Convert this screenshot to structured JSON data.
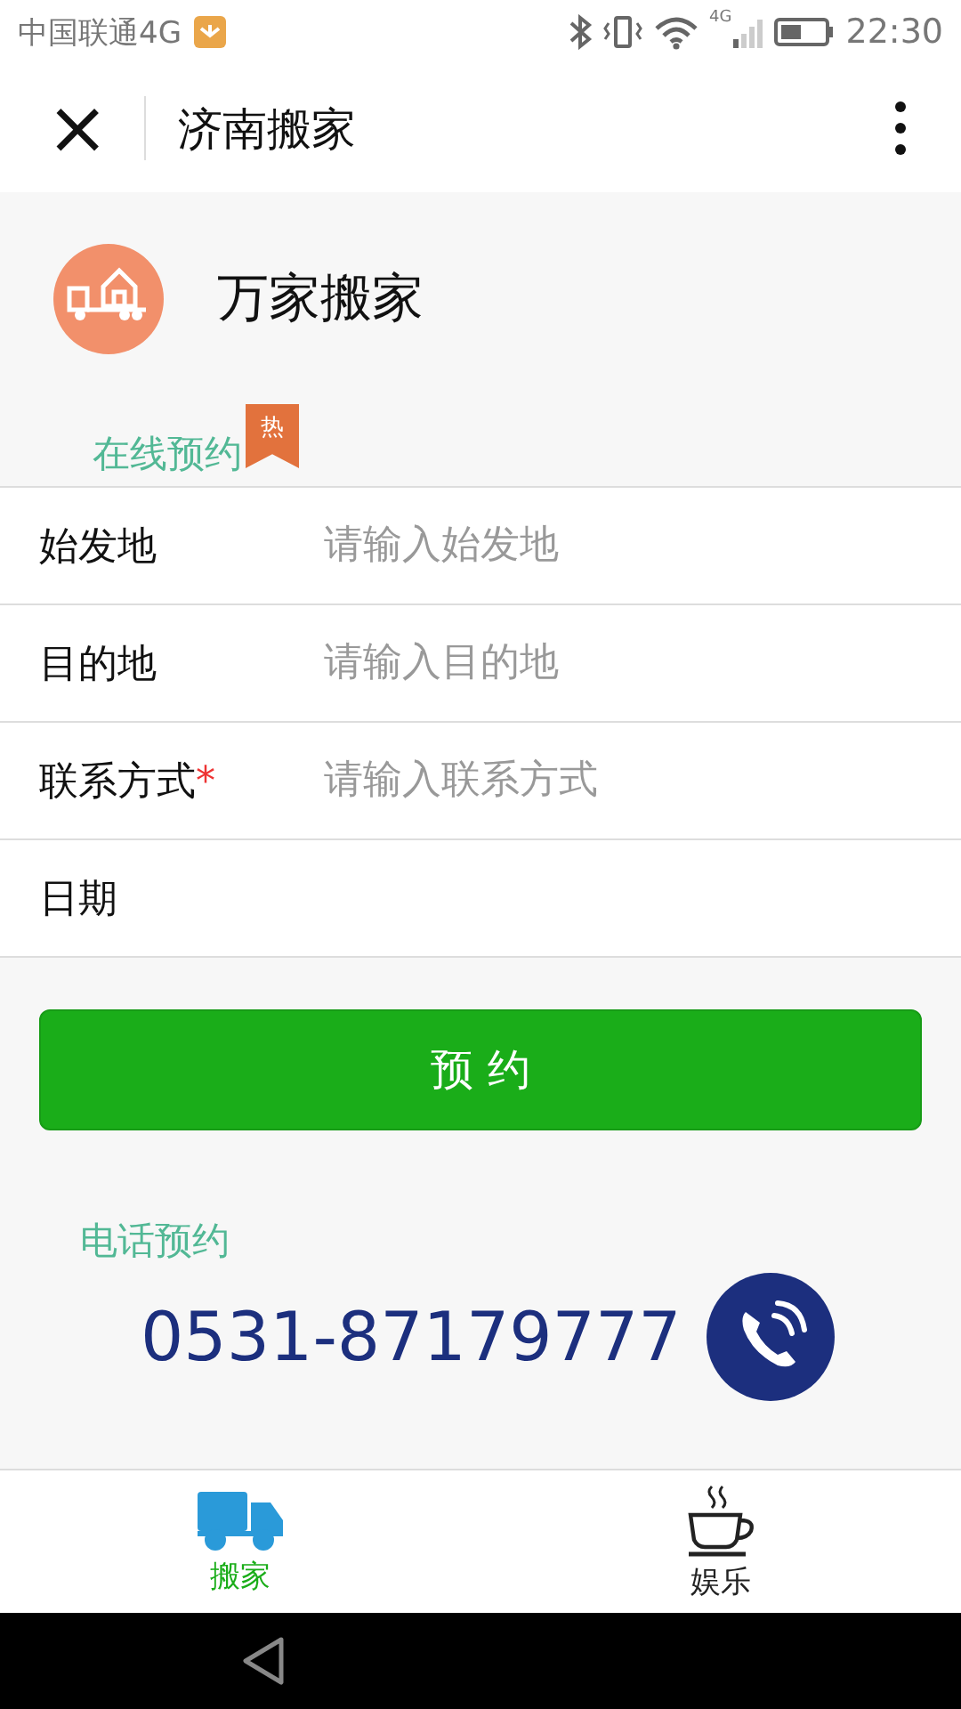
{
  "status_bar": {
    "carrier": "中国联通4G",
    "network": "4G",
    "time": "22:30"
  },
  "header": {
    "title": "济南搬家",
    "close": "×"
  },
  "company": {
    "name": "万家搬家"
  },
  "booking": {
    "title": "在线预约",
    "badge": "热",
    "fields": [
      {
        "label": "始发地",
        "placeholder": "请输入始发地",
        "required": false
      },
      {
        "label": "目的地",
        "placeholder": "请输入目的地",
        "required": false
      },
      {
        "label": "联系方式",
        "placeholder": "请输入联系方式",
        "required": true,
        "required_mark": "*"
      },
      {
        "label": "日期",
        "required": false
      }
    ],
    "submit": "预 约"
  },
  "phone": {
    "title": "电话预约",
    "number": "0531-87179777"
  },
  "tabs": [
    {
      "label": "搬家",
      "kind": "truck",
      "selected": true
    },
    {
      "label": "娱乐",
      "kind": "cup",
      "selected": false
    }
  ]
}
